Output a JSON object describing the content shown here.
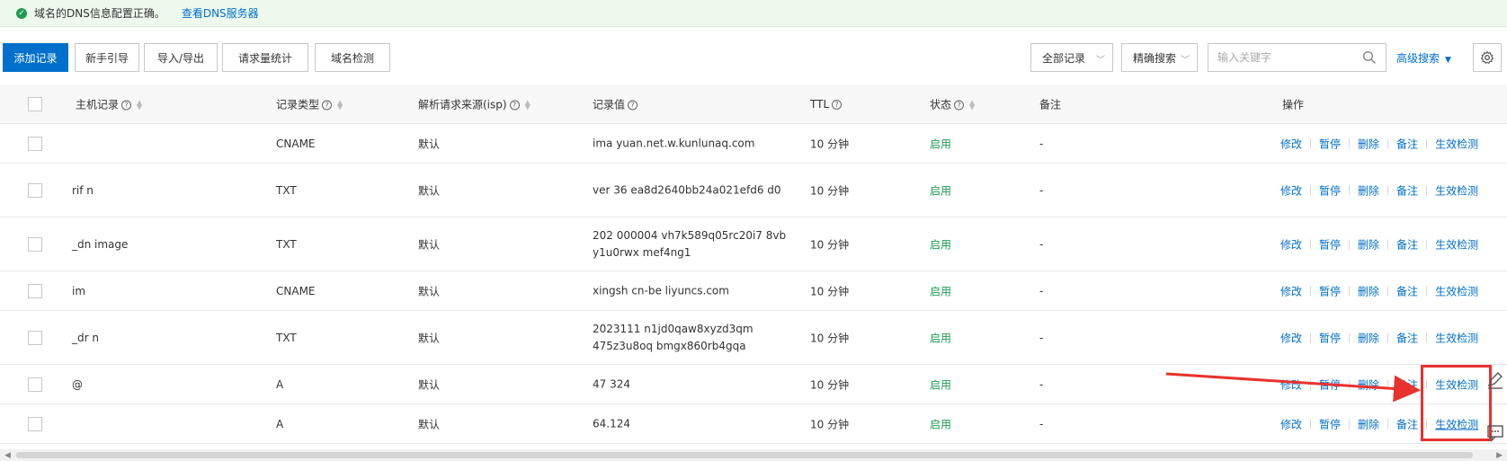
{
  "notice": {
    "text": "域名的DNS信息配置正确。",
    "link": "查看DNS服务器"
  },
  "toolbar": {
    "add": "添加记录",
    "guide": "新手引导",
    "import_export": "导入/导出",
    "stats": "请求量统计",
    "check": "域名检测",
    "all_records": "全部记录",
    "exact_search": "精确搜索",
    "search_placeholder": "输入关键字",
    "advanced": "高级搜索"
  },
  "columns": {
    "host": "主机记录",
    "type": "记录类型",
    "isp": "解析请求来源(isp)",
    "value": "记录值",
    "ttl": "TTL",
    "status": "状态",
    "remark": "备注",
    "ops": "操作"
  },
  "ops": [
    "修改",
    "暂停",
    "删除",
    "备注",
    "生效检测"
  ],
  "rows": [
    {
      "host": "",
      "type": "CNAME",
      "isp": "默认",
      "value": "ima                  yuan.net.w.kunlunaq.com",
      "ttl": "10 分钟",
      "status": "启用",
      "remark": "-"
    },
    {
      "host": "   rif          n",
      "type": "TXT",
      "isp": "默认",
      "value": "ver          36              ea8d2640bb24a021efd6 d0",
      "ttl": "10 分钟",
      "status": "启用",
      "remark": "-"
    },
    {
      "host": "_dn          image",
      "type": "TXT",
      "isp": "默认",
      "value": "202             000004         vh7k589q05rc20i7 8vb            y1u0rwx           mef4ng1",
      "ttl": "10 分钟",
      "status": "启用",
      "remark": "-"
    },
    {
      "host": "im",
      "type": "CNAME",
      "isp": "默认",
      "value": "xingsh             cn-be           liyuncs.com",
      "ttl": "10 分钟",
      "status": "启用",
      "remark": "-"
    },
    {
      "host": "_dr          n",
      "type": "TXT",
      "isp": "默认",
      "value": "2023111                   n1jd0qaw8xyzd3qm 475z3u8oq                 bmgx860rb4gqa",
      "ttl": "10 分钟",
      "status": "启用",
      "remark": "-"
    },
    {
      "host": "@",
      "type": "A",
      "isp": "默认",
      "value": "47             324",
      "ttl": "10 分钟",
      "status": "启用",
      "remark": "-"
    },
    {
      "host": "",
      "type": "A",
      "isp": "默认",
      "value": "              64.124",
      "ttl": "10 分钟",
      "status": "启用",
      "remark": "-"
    }
  ]
}
